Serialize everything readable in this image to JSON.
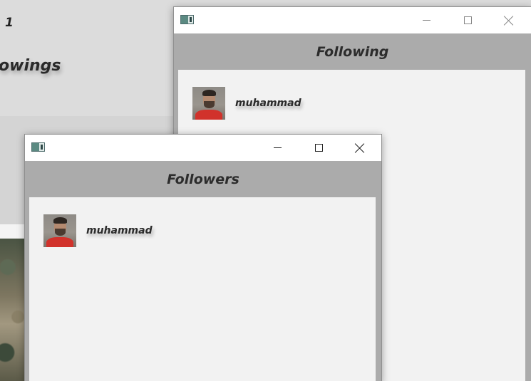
{
  "background_app": {
    "count_value": "1",
    "heading_fragment": "owings"
  },
  "following_window": {
    "title": "Following",
    "icon": "app-window-icon",
    "controls": {
      "minimize": "minimize-icon",
      "maximize": "maximize-icon",
      "close": "close-icon"
    },
    "items": [
      {
        "username": "muhammad",
        "avatar": "profile-photo"
      }
    ]
  },
  "followers_window": {
    "title": "Followers",
    "icon": "app-window-icon",
    "controls": {
      "minimize": "minimize-icon",
      "maximize": "maximize-icon",
      "close": "close-icon"
    },
    "items": [
      {
        "username": "muhammad",
        "avatar": "profile-photo"
      }
    ]
  },
  "colors": {
    "header_band": "#ababab",
    "list_background": "#f2f2f2",
    "avatar_shirt": "#d1322b"
  }
}
